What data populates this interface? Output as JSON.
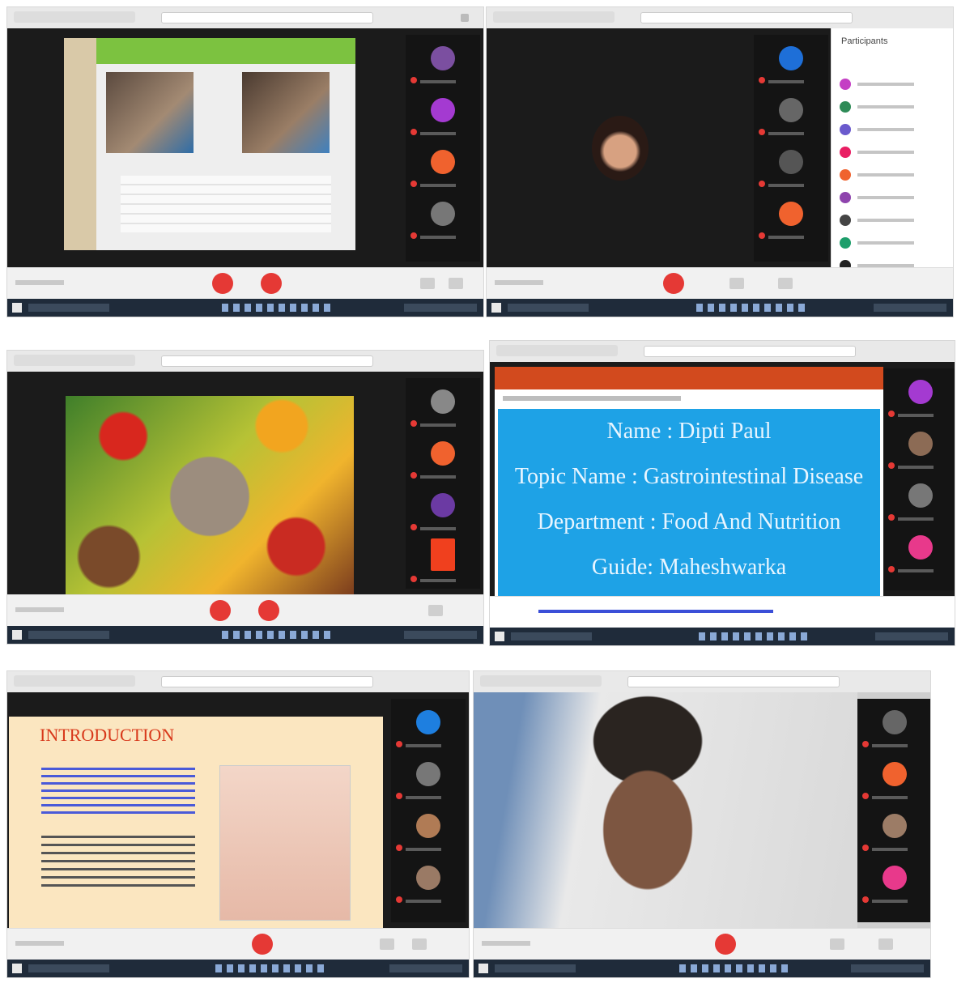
{
  "panels": [
    {
      "id": "p1",
      "stage": "title-card"
    },
    {
      "id": "p2",
      "stage": "participants-list",
      "people_label": "Participants"
    },
    {
      "id": "p3",
      "stage": "food-photo"
    },
    {
      "id": "p4",
      "stage": "title-slide",
      "slide_lines": [
        "Name : Dipti Paul",
        "Topic Name : Gastrointestinal Disease",
        "Department : Food And Nutrition",
        "Guide: Maheshwarka"
      ]
    },
    {
      "id": "p5",
      "stage": "intro-slide",
      "slide_heading": "INTRODUCTION"
    },
    {
      "id": "p6",
      "stage": "webcam"
    }
  ],
  "colors": {
    "accent": "#e53935",
    "slide_blue": "#1ea2e6",
    "intro_bg": "#fbe6c0",
    "heading_red": "#d8391b"
  },
  "icons": {
    "mic": "mic-icon",
    "camera": "camera-icon",
    "leave": "leave-icon"
  }
}
